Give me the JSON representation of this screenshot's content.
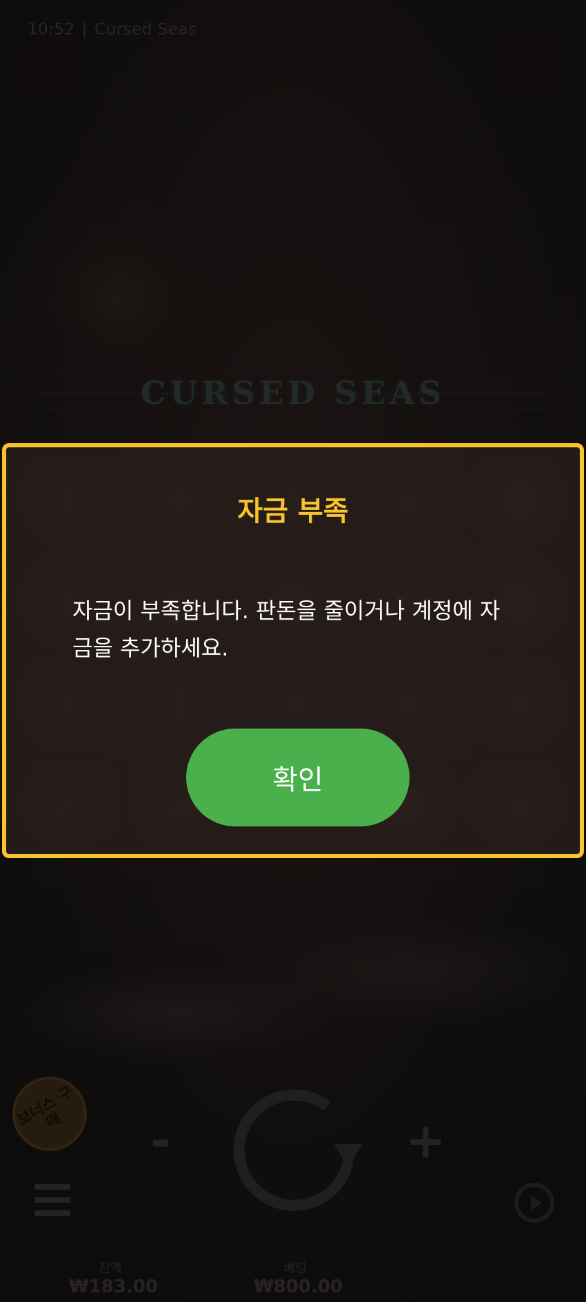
{
  "status_bar": {
    "time": "10:52",
    "separator": "|",
    "game_name": "Cursed Seas"
  },
  "game": {
    "logo_text": "CURSED SEAS",
    "buy_bonus_label": "보너스 구매",
    "minus_label": "-",
    "plus_label": "+",
    "balance_label": "잔액",
    "balance_value": "₩183.00",
    "bet_label": "베팅",
    "bet_value": "₩800.00"
  },
  "dialog": {
    "title": "자금 부족",
    "message": "자금이 부족합니다. 판돈을 줄이거나 계정에 자금을 추가하세요.",
    "ok_label": "확인",
    "colors": {
      "border": "#f7c42e",
      "title": "#f7c42e",
      "button": "#49b04b"
    }
  },
  "icons": [
    "anchor-icon",
    "compass-icon",
    "skull-icon",
    "pirate-icon",
    "menu-icon",
    "spin-icon",
    "autoplay-icon"
  ]
}
